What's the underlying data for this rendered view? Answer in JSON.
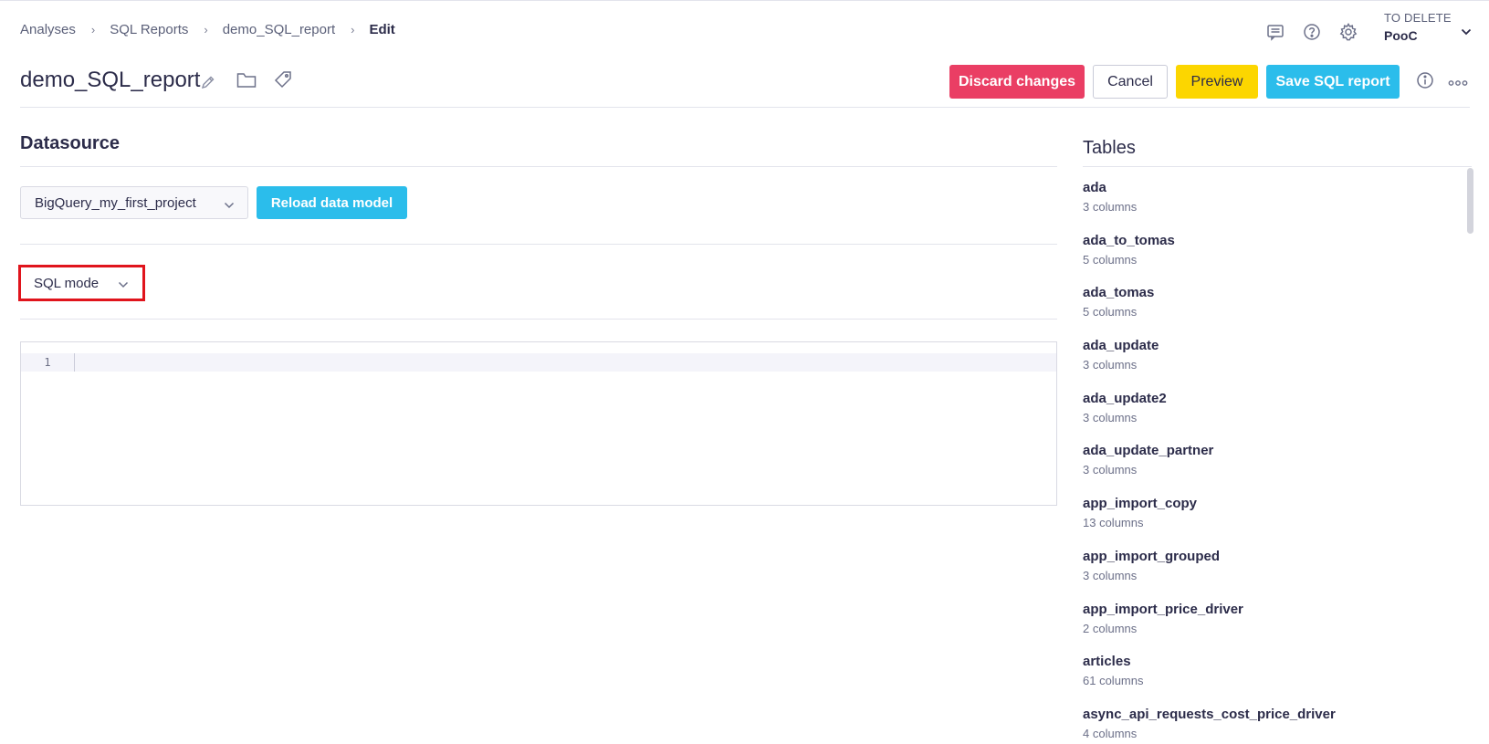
{
  "breadcrumb": {
    "items": [
      "Analyses",
      "SQL Reports",
      "demo_SQL_report"
    ],
    "current": "Edit"
  },
  "header": {
    "icons": [
      "comment-icon",
      "help-icon",
      "settings-icon"
    ],
    "workspace_label": "TO DELETE",
    "workspace_name": "PooC"
  },
  "report": {
    "title": "demo_SQL_report"
  },
  "toolbar": {
    "discard_label": "Discard changes",
    "cancel_label": "Cancel",
    "preview_label": "Preview",
    "save_label": "Save SQL report"
  },
  "datasource": {
    "section_title": "Datasource",
    "selected": "BigQuery_my_first_project",
    "reload_label": "Reload data model",
    "mode": "SQL mode"
  },
  "editor": {
    "line_number": "1",
    "content": ""
  },
  "tables": {
    "title": "Tables",
    "items": [
      {
        "name": "ada",
        "columns": "3 columns"
      },
      {
        "name": "ada_to_tomas",
        "columns": "5 columns"
      },
      {
        "name": "ada_tomas",
        "columns": "5 columns"
      },
      {
        "name": "ada_update",
        "columns": "3 columns"
      },
      {
        "name": "ada_update2",
        "columns": "3 columns"
      },
      {
        "name": "ada_update_partner",
        "columns": "3 columns"
      },
      {
        "name": "app_import_copy",
        "columns": "13 columns"
      },
      {
        "name": "app_import_grouped",
        "columns": "3 columns"
      },
      {
        "name": "app_import_price_driver",
        "columns": "2 columns"
      },
      {
        "name": "articles",
        "columns": "61 columns"
      },
      {
        "name": "async_api_requests_cost_price_driver",
        "columns": "4 columns"
      }
    ]
  },
  "colors": {
    "discard": "#ea3e64",
    "preview": "#fcd600",
    "primary": "#2bbdeb",
    "highlight": "#e0141c"
  }
}
